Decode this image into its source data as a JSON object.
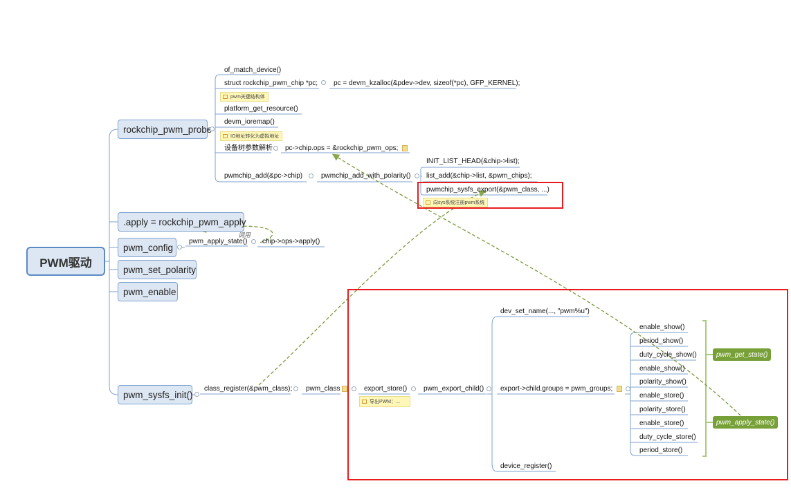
{
  "root": {
    "label": "PWM驱动"
  },
  "topics": {
    "probe": "rockchip_pwm_probe",
    "apply": ".apply = rockchip_pwm_apply",
    "config": "pwm_config",
    "set_polarity": "pwm_set_polarity",
    "enable": "pwm_enable",
    "sysfs_init": "pwm_sysfs_init()"
  },
  "probe_children": {
    "of_match": "of_match_device()",
    "struct_chip": "struct rockchip_pwm_chip *pc;",
    "devm_kzalloc": "pc = devm_kzalloc(&pdev->dev, sizeof(*pc), GFP_KERNEL);",
    "note_struct": "pwm关键结构体",
    "platform_get_resource": "platform_get_resource()",
    "devm_ioremap": "devm_ioremap()",
    "note_ioremap": "IO地址转化为虚拟地址",
    "dt_parse": "设备树参数解析",
    "chip_ops": "pc->chip.ops = &rockchip_pwm_ops;",
    "pwmchip_add": "pwmchip_add(&pc->chip)",
    "add_with_polarity": "pwmchip_add_with_polarity()",
    "init_list_head": "INIT_LIST_HEAD(&chip->list);",
    "list_add": "list_add(&chip->list, &pwm_chips);",
    "sysfs_export": "pwmchip_sysfs_export(&pwm_class, ...)",
    "note_sysfs": "向sys系统注册pwm系统"
  },
  "config_children": {
    "apply_state": "pwm_apply_state()",
    "ops_apply": "chip->ops->apply()",
    "call_label": "调用"
  },
  "sysfs_children": {
    "class_register": "class_register(&pwm_class);",
    "pwm_class": "pwm_class",
    "export_store": "export_store()",
    "note_export": "导出PWM：...",
    "pwm_export_child": "pwm_export_child()",
    "dev_set_name": "dev_set_name(..., \"pwm%u\")",
    "groups": "export->child.groups = pwm_groups;",
    "device_register": "device_register()",
    "attrs": [
      "enable_show()",
      "period_show()",
      "duty_cycle_show()",
      "enable_show()",
      "polarity_show()",
      "enable_store()",
      "polarity_store()",
      "enable_store()",
      "duty_cycle_store()",
      "period_store()"
    ]
  },
  "summaries": {
    "get_state": "pwm_get_state()",
    "apply_state": "pwm_apply_state()"
  },
  "colors": {
    "topic_fill": "#dde7f3",
    "topic_border": "#7ea2cf",
    "branch_line": "#7ea2cf",
    "dashed_arrow": "#6b8f2a",
    "summary_fill": "#78a038",
    "highlight": "#e81c1c"
  }
}
